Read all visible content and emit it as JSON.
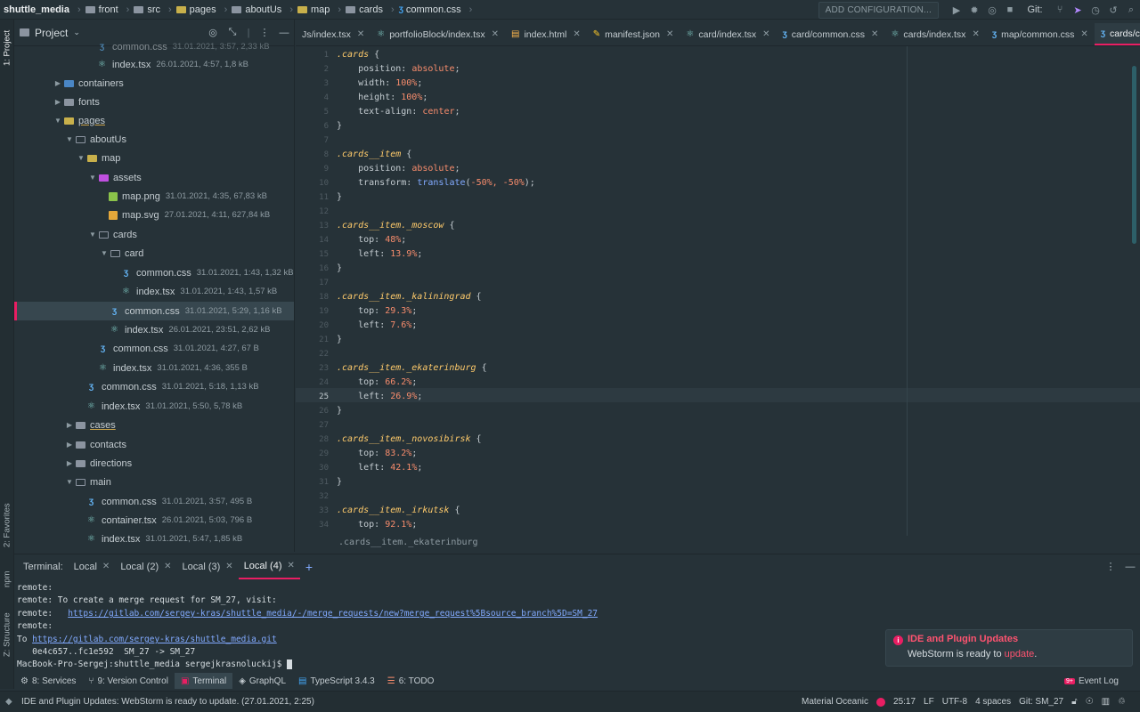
{
  "nav": {
    "project": "shuttle_media",
    "crumbs": [
      "front",
      "src",
      "pages",
      "aboutUs",
      "map",
      "cards",
      "common.css"
    ],
    "add_config": "ADD CONFIGURATION...",
    "git_label": "Git:"
  },
  "left_strip": {
    "project": "1: Project",
    "favorites": "2: Favorites",
    "npm": "npm",
    "structure": "Z: Structure"
  },
  "project_panel": {
    "title": "Project",
    "tree": [
      {
        "name": "common.css",
        "meta": "31.01.2021, 3:57, 2,33 kB",
        "kind": "css"
      },
      {
        "name": "index.tsx",
        "meta": "26.01.2021, 4:57, 1,8 kB",
        "kind": "react"
      },
      {
        "name": "containers",
        "meta": "",
        "kind": "folder-b"
      },
      {
        "name": "fonts",
        "meta": "",
        "kind": "folder"
      },
      {
        "name": "pages",
        "meta": "",
        "kind": "folder-y"
      },
      {
        "name": "aboutUs",
        "meta": "",
        "kind": "folder"
      },
      {
        "name": "map",
        "meta": "",
        "kind": "folder-y"
      },
      {
        "name": "assets",
        "meta": "",
        "kind": "folder-p"
      },
      {
        "name": "map.png",
        "meta": "31.01.2021, 4:35, 67,83 kB",
        "kind": "img"
      },
      {
        "name": "map.svg",
        "meta": "27.01.2021, 4:11, 627,84 kB",
        "kind": "svg"
      },
      {
        "name": "cards",
        "meta": "",
        "kind": "folder"
      },
      {
        "name": "card",
        "meta": "",
        "kind": "folder"
      },
      {
        "name": "common.css",
        "meta": "31.01.2021, 1:43, 1,32 kB",
        "kind": "css"
      },
      {
        "name": "index.tsx",
        "meta": "31.01.2021, 1:43, 1,57 kB",
        "kind": "react"
      },
      {
        "name": "common.css",
        "meta": "31.01.2021, 5:29, 1,16 kB",
        "kind": "css"
      },
      {
        "name": "index.tsx",
        "meta": "26.01.2021, 23:51, 2,62 kB",
        "kind": "react"
      },
      {
        "name": "common.css",
        "meta": "31.01.2021, 4:27, 67 B",
        "kind": "css"
      },
      {
        "name": "index.tsx",
        "meta": "31.01.2021, 4:36, 355 B",
        "kind": "react"
      },
      {
        "name": "common.css",
        "meta": "31.01.2021, 5:18, 1,13 kB",
        "kind": "css"
      },
      {
        "name": "index.tsx",
        "meta": "31.01.2021, 5:50, 5,78 kB",
        "kind": "react"
      },
      {
        "name": "cases",
        "meta": "",
        "kind": "folder"
      },
      {
        "name": "contacts",
        "meta": "",
        "kind": "folder"
      },
      {
        "name": "directions",
        "meta": "",
        "kind": "folder"
      },
      {
        "name": "main",
        "meta": "",
        "kind": "folder"
      },
      {
        "name": "common.css",
        "meta": "31.01.2021, 3:57, 495 B",
        "kind": "css"
      },
      {
        "name": "container.tsx",
        "meta": "26.01.2021, 5:03, 796 B",
        "kind": "react"
      },
      {
        "name": "index.tsx",
        "meta": "31.01.2021, 5:47, 1,85 kB",
        "kind": "react"
      }
    ]
  },
  "tabs": [
    {
      "label": "Js/index.tsx",
      "icon": "react"
    },
    {
      "label": "portfolioBlock/index.tsx",
      "icon": "react"
    },
    {
      "label": "index.html",
      "icon": "html"
    },
    {
      "label": "manifest.json",
      "icon": "json"
    },
    {
      "label": "card/index.tsx",
      "icon": "react"
    },
    {
      "label": "card/common.css",
      "icon": "css"
    },
    {
      "label": "cards/index.tsx",
      "icon": "react"
    },
    {
      "label": "map/common.css",
      "icon": "css"
    },
    {
      "label": "cards/common.css",
      "icon": "css"
    }
  ],
  "editor": {
    "current_line": 25,
    "breadcrumb": ".cards__item._ekaterinburg",
    "line_numbers": [
      "1",
      "2",
      "3",
      "4",
      "5",
      "6",
      "7",
      "8",
      "9",
      "10",
      "11",
      "12",
      "13",
      "14",
      "15",
      "16",
      "17",
      "18",
      "19",
      "20",
      "21",
      "22",
      "23",
      "24",
      "25",
      "26",
      "27",
      "28",
      "29",
      "30",
      "31",
      "32",
      "33",
      "34"
    ],
    "lines": [
      {
        "sel": ".cards",
        "rest": " {"
      },
      {
        "prop": "position",
        "val": "absolute"
      },
      {
        "prop": "width",
        "val": "100%"
      },
      {
        "prop": "height",
        "val": "100%"
      },
      {
        "prop": "text-align",
        "val": "center"
      },
      {
        "close": "}"
      },
      {
        "blank": ""
      },
      {
        "sel": ".cards__item",
        "rest": " {"
      },
      {
        "prop": "position",
        "val": "absolute"
      },
      {
        "prop": "transform",
        "fn": "translate",
        "args": "-50%, -50%"
      },
      {
        "close": "}"
      },
      {
        "blank": ""
      },
      {
        "sel": ".cards__item._moscow",
        "rest": " {"
      },
      {
        "prop": "top",
        "val": "48%"
      },
      {
        "prop": "left",
        "val": "13.9%"
      },
      {
        "close": "}"
      },
      {
        "blank": ""
      },
      {
        "sel": ".cards__item._kaliningrad",
        "rest": " {"
      },
      {
        "prop": "top",
        "val": "29.3%"
      },
      {
        "prop": "left",
        "val": "7.6%"
      },
      {
        "close": "}"
      },
      {
        "blank": ""
      },
      {
        "sel": ".cards__item._ekaterinburg",
        "rest": " {"
      },
      {
        "prop": "top",
        "val": "66.2%"
      },
      {
        "prop": "left",
        "val": "26.9%"
      },
      {
        "close": "}"
      },
      {
        "blank": ""
      },
      {
        "sel": ".cards__item._novosibirsk",
        "rest": " {"
      },
      {
        "prop": "top",
        "val": "83.2%"
      },
      {
        "prop": "left",
        "val": "42.1%"
      },
      {
        "close": "}"
      },
      {
        "blank": ""
      },
      {
        "sel": ".cards__item._irkutsk",
        "rest": " {"
      },
      {
        "prop": "top",
        "val": "92.1%"
      }
    ]
  },
  "terminal": {
    "label": "Terminal:",
    "tabs": [
      "Local",
      "Local (2)",
      "Local (3)",
      "Local (4)"
    ],
    "lines": [
      {
        "text": "remote:"
      },
      {
        "text": "remote: To create a merge request for SM_27, visit:"
      },
      {
        "text": "remote:   ",
        "link": "https://gitlab.com/sergey-kras/shuttle_media/-/merge_requests/new?merge_request%5Bsource_branch%5D=SM_27"
      },
      {
        "text": "remote:"
      },
      {
        "text": "To ",
        "link": "https://gitlab.com/sergey-kras/shuttle_media.git"
      },
      {
        "text": "   0e4c657..fc1e592  SM_27 -> SM_27"
      },
      {
        "text": "MacBook-Pro-Sergej:shuttle_media sergejkrasnoluckij$ "
      }
    ]
  },
  "notification": {
    "title": "IDE and Plugin Updates",
    "body": "WebStorm is ready to ",
    "action": "update",
    "end": "."
  },
  "toolwindows": [
    {
      "label": "8: Services",
      "icon": "⚙"
    },
    {
      "label": "9: Version Control",
      "icon": "⑂"
    },
    {
      "label": "Terminal",
      "icon": "▣"
    },
    {
      "label": "GraphQL",
      "icon": "◈"
    },
    {
      "label": "TypeScript 3.4.3",
      "icon": "▤"
    },
    {
      "label": "6: TODO",
      "icon": "☰"
    }
  ],
  "event_log": "Event Log",
  "status": {
    "message": "IDE and Plugin Updates: WebStorm is ready to update. (27.01.2021, 2:25)",
    "theme": "Material Oceanic",
    "position": "25:17",
    "line_sep": "LF",
    "encoding": "UTF-8",
    "indent": "4 spaces",
    "git": "Git: SM_27"
  }
}
